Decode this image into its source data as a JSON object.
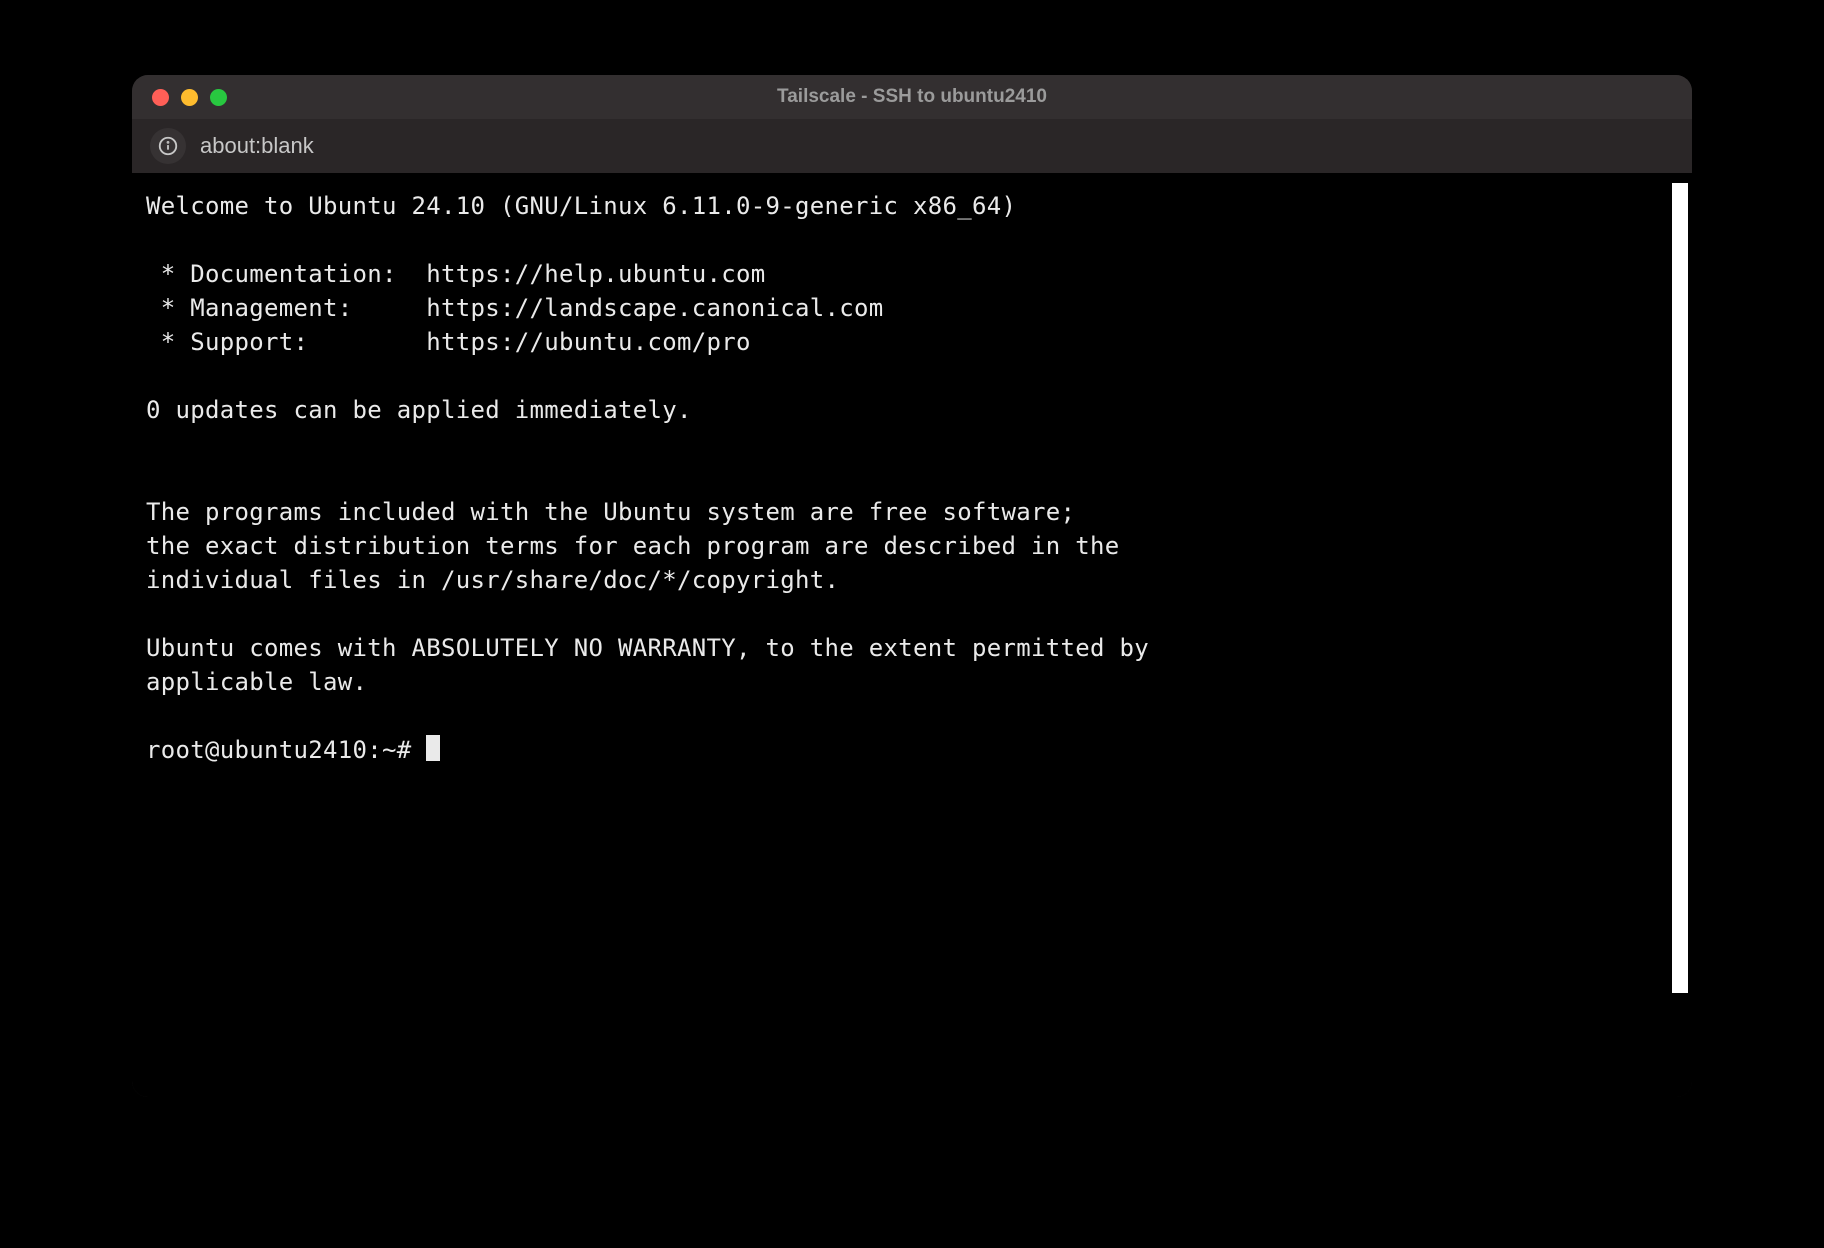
{
  "window": {
    "title": "Tailscale - SSH to ubuntu2410"
  },
  "addressbar": {
    "url": "about:blank"
  },
  "terminal": {
    "lines": [
      "Welcome to Ubuntu 24.10 (GNU/Linux 6.11.0-9-generic x86_64)",
      "",
      " * Documentation:  https://help.ubuntu.com",
      " * Management:     https://landscape.canonical.com",
      " * Support:        https://ubuntu.com/pro",
      "",
      "0 updates can be applied immediately.",
      "",
      "",
      "The programs included with the Ubuntu system are free software;",
      "the exact distribution terms for each program are described in the",
      "individual files in /usr/share/doc/*/copyright.",
      "",
      "Ubuntu comes with ABSOLUTELY NO WARRANTY, to the extent permitted by",
      "applicable law.",
      ""
    ],
    "prompt": "root@ubuntu2410:~# "
  }
}
